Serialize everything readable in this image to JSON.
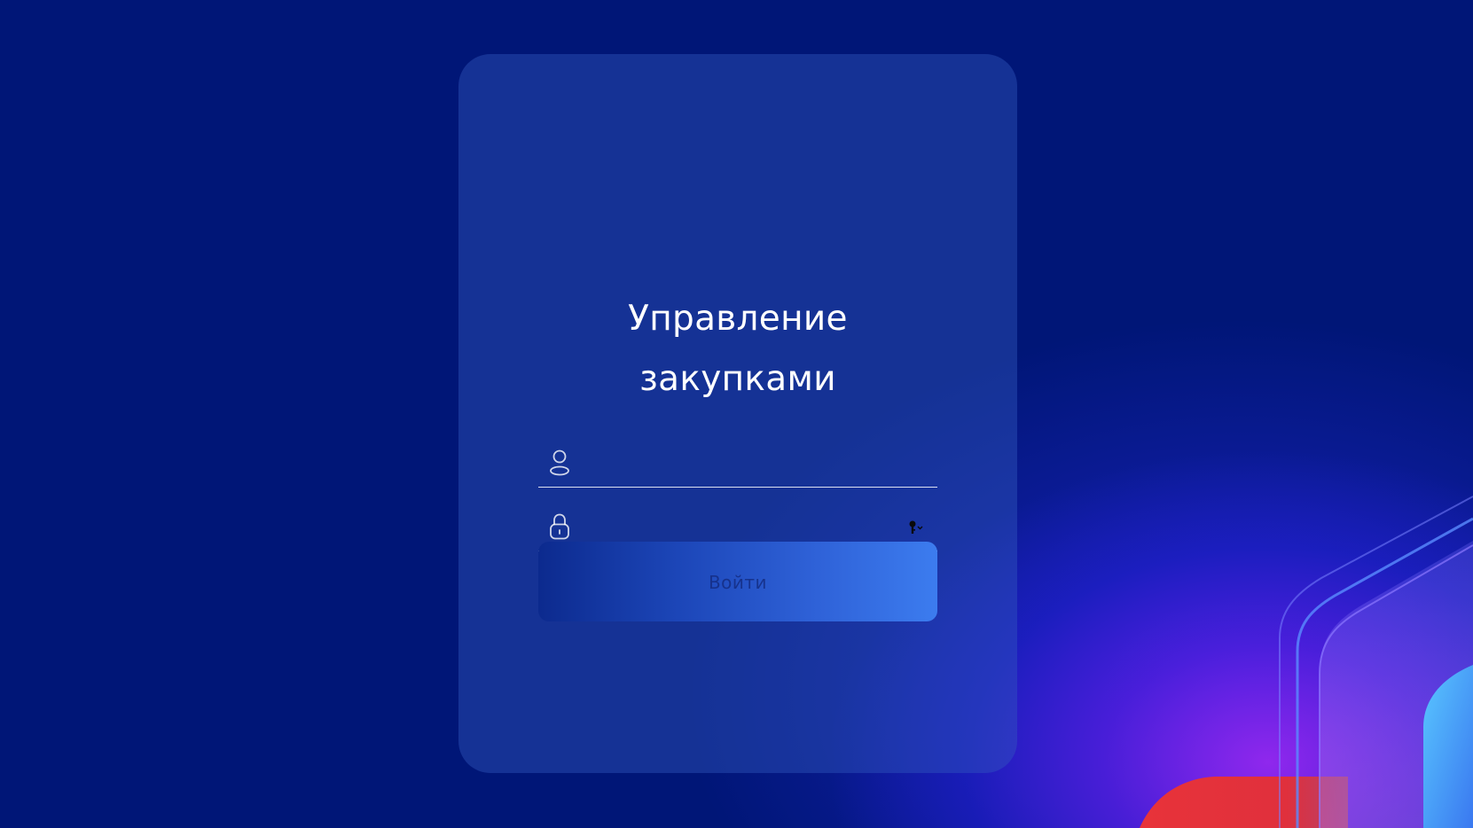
{
  "login_form": {
    "title_line1": "Управление",
    "title_line2": "закупками",
    "username": {
      "icon": "user-icon",
      "value": "",
      "placeholder": ""
    },
    "password": {
      "icon": "lock-icon",
      "value": "",
      "placeholder": "",
      "reveal_icon": "key-icon"
    },
    "submit_label": "Войти"
  },
  "colors": {
    "background": "#001677",
    "card": "#1a3590",
    "button_start": "#0c2a8e",
    "button_end": "#3c7cef",
    "deco_red": "#e8333a",
    "deco_cyan": "#4aa8ff",
    "deco_glow": "#9a28f0"
  }
}
